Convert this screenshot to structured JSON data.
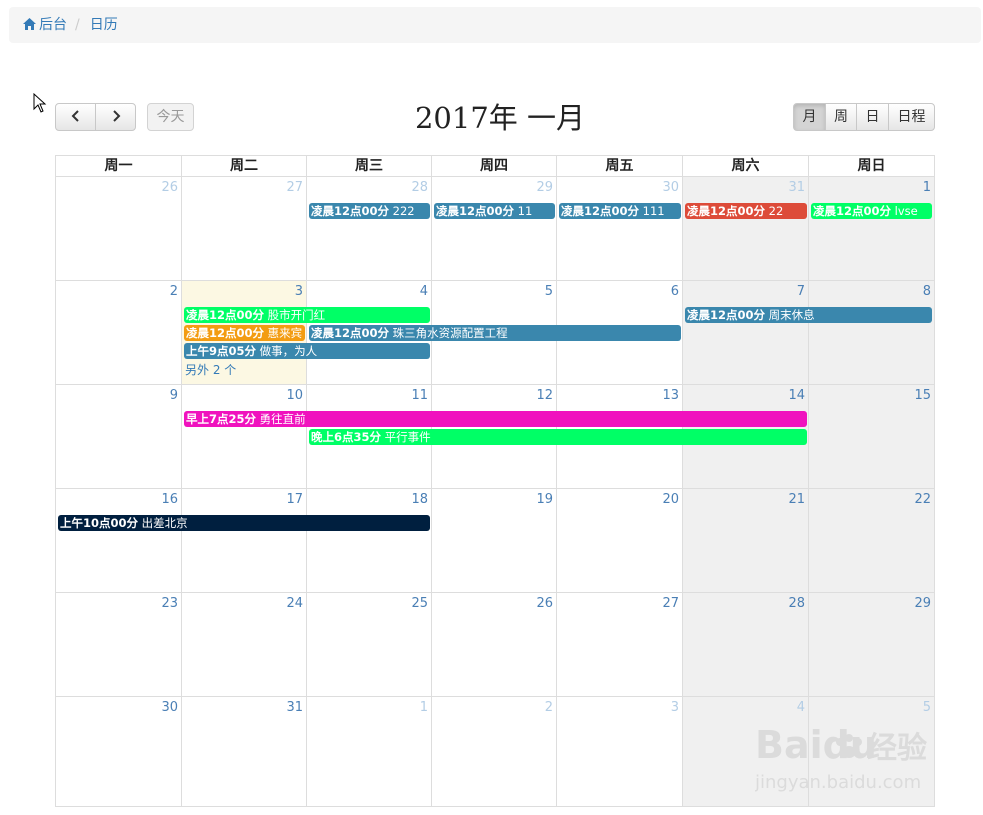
{
  "breadcrumb": {
    "home": "后台",
    "current": "日历"
  },
  "toolbar": {
    "prev_icon": "chevron-left-icon",
    "next_icon": "chevron-right-icon",
    "today": "今天",
    "title": "2017年 一月",
    "views": [
      "月",
      "周",
      "日",
      "日程"
    ],
    "active_view": "月"
  },
  "weekdays": [
    "周一",
    "周二",
    "周三",
    "周四",
    "周五",
    "周六",
    "周日"
  ],
  "weeks": [
    [
      "26",
      "27",
      "28",
      "29",
      "30",
      "31",
      "1"
    ],
    [
      "2",
      "3",
      "4",
      "5",
      "6",
      "7",
      "8"
    ],
    [
      "9",
      "10",
      "11",
      "12",
      "13",
      "14",
      "15"
    ],
    [
      "16",
      "17",
      "18",
      "19",
      "20",
      "21",
      "22"
    ],
    [
      "23",
      "24",
      "25",
      "26",
      "27",
      "28",
      "29"
    ],
    [
      "30",
      "31",
      "1",
      "2",
      "3",
      "4",
      "5"
    ]
  ],
  "events": [
    {
      "time": "凌晨12点00分",
      "title": "222",
      "color": "#3a87ad"
    },
    {
      "time": "凌晨12点00分",
      "title": "11",
      "color": "#3a87ad"
    },
    {
      "time": "凌晨12点00分",
      "title": "111",
      "color": "#3a87ad"
    },
    {
      "time": "凌晨12点00分",
      "title": "22",
      "color": "#dd4b39"
    },
    {
      "time": "凌晨12点00分",
      "title": "lvse",
      "color": "#00ff66"
    },
    {
      "time": "凌晨12点00分",
      "title": "股市开门红",
      "color": "#00ff66"
    },
    {
      "time": "凌晨12点00分",
      "title": "惠来宾",
      "color": "#f39c12"
    },
    {
      "time": "凌晨12点00分",
      "title": "珠三角水资源配置工程",
      "color": "#3a87ad"
    },
    {
      "time": "上午9点05分",
      "title": "做事，为人",
      "color": "#3a87ad"
    },
    {
      "time": "凌晨12点00分",
      "title": "周末休息",
      "color": "#3a87ad"
    },
    {
      "time": "早上7点25分",
      "title": "勇往直前",
      "color": "#f012be"
    },
    {
      "time": "晚上6点35分",
      "title": "平行事件",
      "color": "#00ff66"
    },
    {
      "time": "上午10点00分",
      "title": "出差北京",
      "color": "#001f3f"
    }
  ],
  "more_link": "另外 2 个",
  "watermark": {
    "logo": "Baidu",
    "text": "经验",
    "url": "jingyan.baidu.com"
  }
}
